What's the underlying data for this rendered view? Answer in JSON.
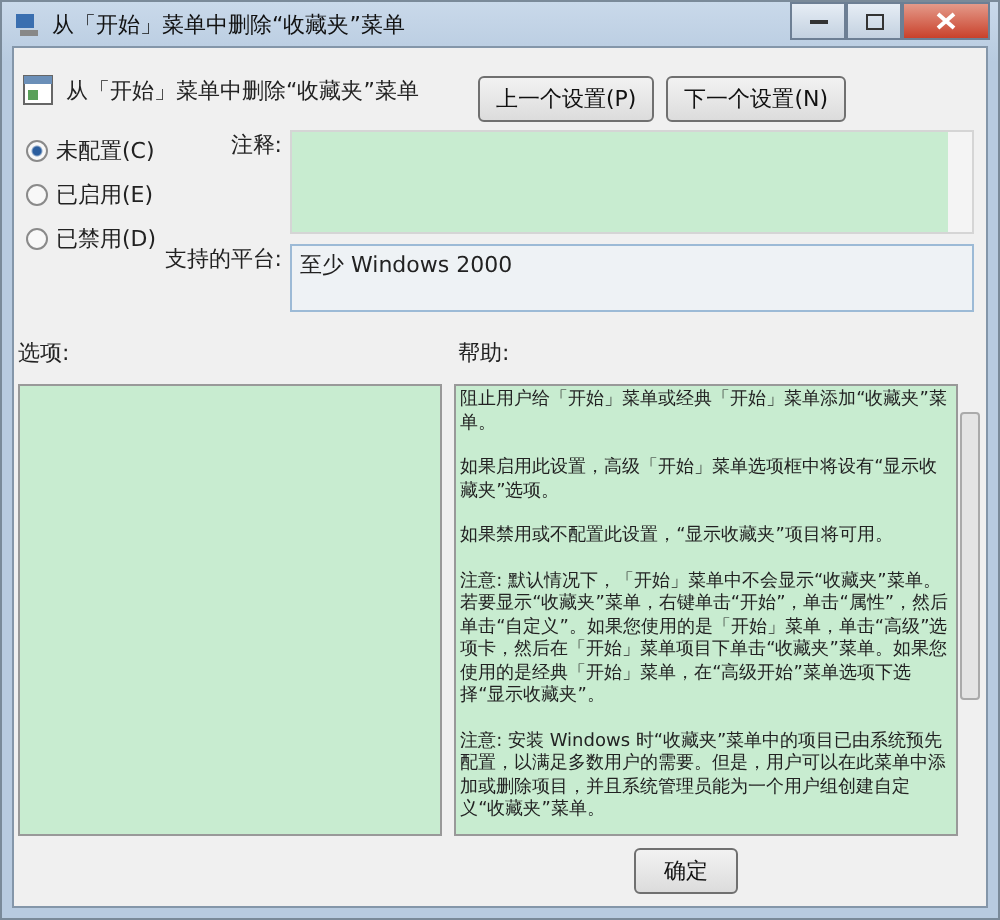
{
  "window": {
    "title": "从「开始」菜单中删除“收藏夹”菜单"
  },
  "header": {
    "title": "从「开始」菜单中删除“收藏夹”菜单",
    "buttons": [
      "上一个设置(P)",
      "下一个设置(N)"
    ]
  },
  "options": [
    {
      "label": "未配置(C)",
      "selected": true
    },
    {
      "label": "已启用(E)",
      "selected": false
    },
    {
      "label": "已禁用(D)",
      "selected": false
    }
  ],
  "comment": {
    "label": "注释:"
  },
  "platform": {
    "label": "支持的平台:",
    "value": "至少 Windows 2000"
  },
  "options_label": "选项:",
  "help": {
    "label": "帮助:",
    "paragraphs": [
      "阻止用户给「开始」菜单或经典「开始」菜单添加“收藏夹”菜单。",
      "如果启用此设置，高级「开始」菜单选项框中将设有“显示收藏夹”选项。",
      "如果禁用或不配置此设置，“显示收藏夹”项目将可用。",
      "注意: 默认情况下，「开始」菜单中不会显示“收藏夹”菜单。若要显示“收藏夹”菜单，右键单击“开始”，单击“属性”，然后单击“自定义”。如果您使用的是「开始」菜单，单击“高级”选项卡，然后在「开始」菜单项目下单击“收藏夹”菜单。如果您使用的是经典「开始」菜单，在“高级开始”菜单选项下选择“显示收藏夹”。",
      "注意: 安装 Windows 时“收藏夹”菜单中的项目已由系统预先配置，以满足多数用户的需要。但是，用户可以在此菜单中添加或删除项目，并且系统管理员能为一个用户组创建自定义“收藏夹”菜单。"
    ]
  },
  "buttons": [
    "确定"
  ]
}
